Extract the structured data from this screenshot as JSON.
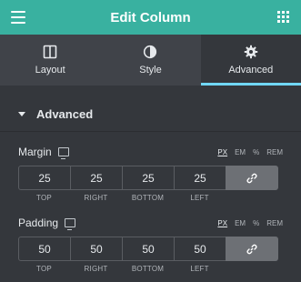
{
  "header": {
    "title": "Edit Column",
    "menu_icon": "hamburger-icon",
    "apps_icon": "grid-icon"
  },
  "tabs": [
    {
      "label": "Layout",
      "icon": "layout-icon",
      "active": false
    },
    {
      "label": "Style",
      "icon": "style-icon",
      "active": false
    },
    {
      "label": "Advanced",
      "icon": "gear-icon",
      "active": true
    }
  ],
  "section": {
    "title": "Advanced",
    "expanded": true
  },
  "margin": {
    "label": "Margin",
    "units": [
      "PX",
      "EM",
      "%",
      "REM"
    ],
    "active_unit": "PX",
    "values": [
      "25",
      "25",
      "25",
      "25"
    ],
    "sides": [
      "TOP",
      "RIGHT",
      "BOTTOM",
      "LEFT"
    ]
  },
  "padding": {
    "label": "Padding",
    "units": [
      "PX",
      "EM",
      "%",
      "REM"
    ],
    "active_unit": "PX",
    "values": [
      "50",
      "50",
      "50",
      "50"
    ],
    "sides": [
      "TOP",
      "RIGHT",
      "BOTTOM",
      "LEFT"
    ]
  },
  "colors": {
    "header": "#39b1a0",
    "active_tab_underline": "#71d7f7",
    "panel": "#34373c"
  }
}
